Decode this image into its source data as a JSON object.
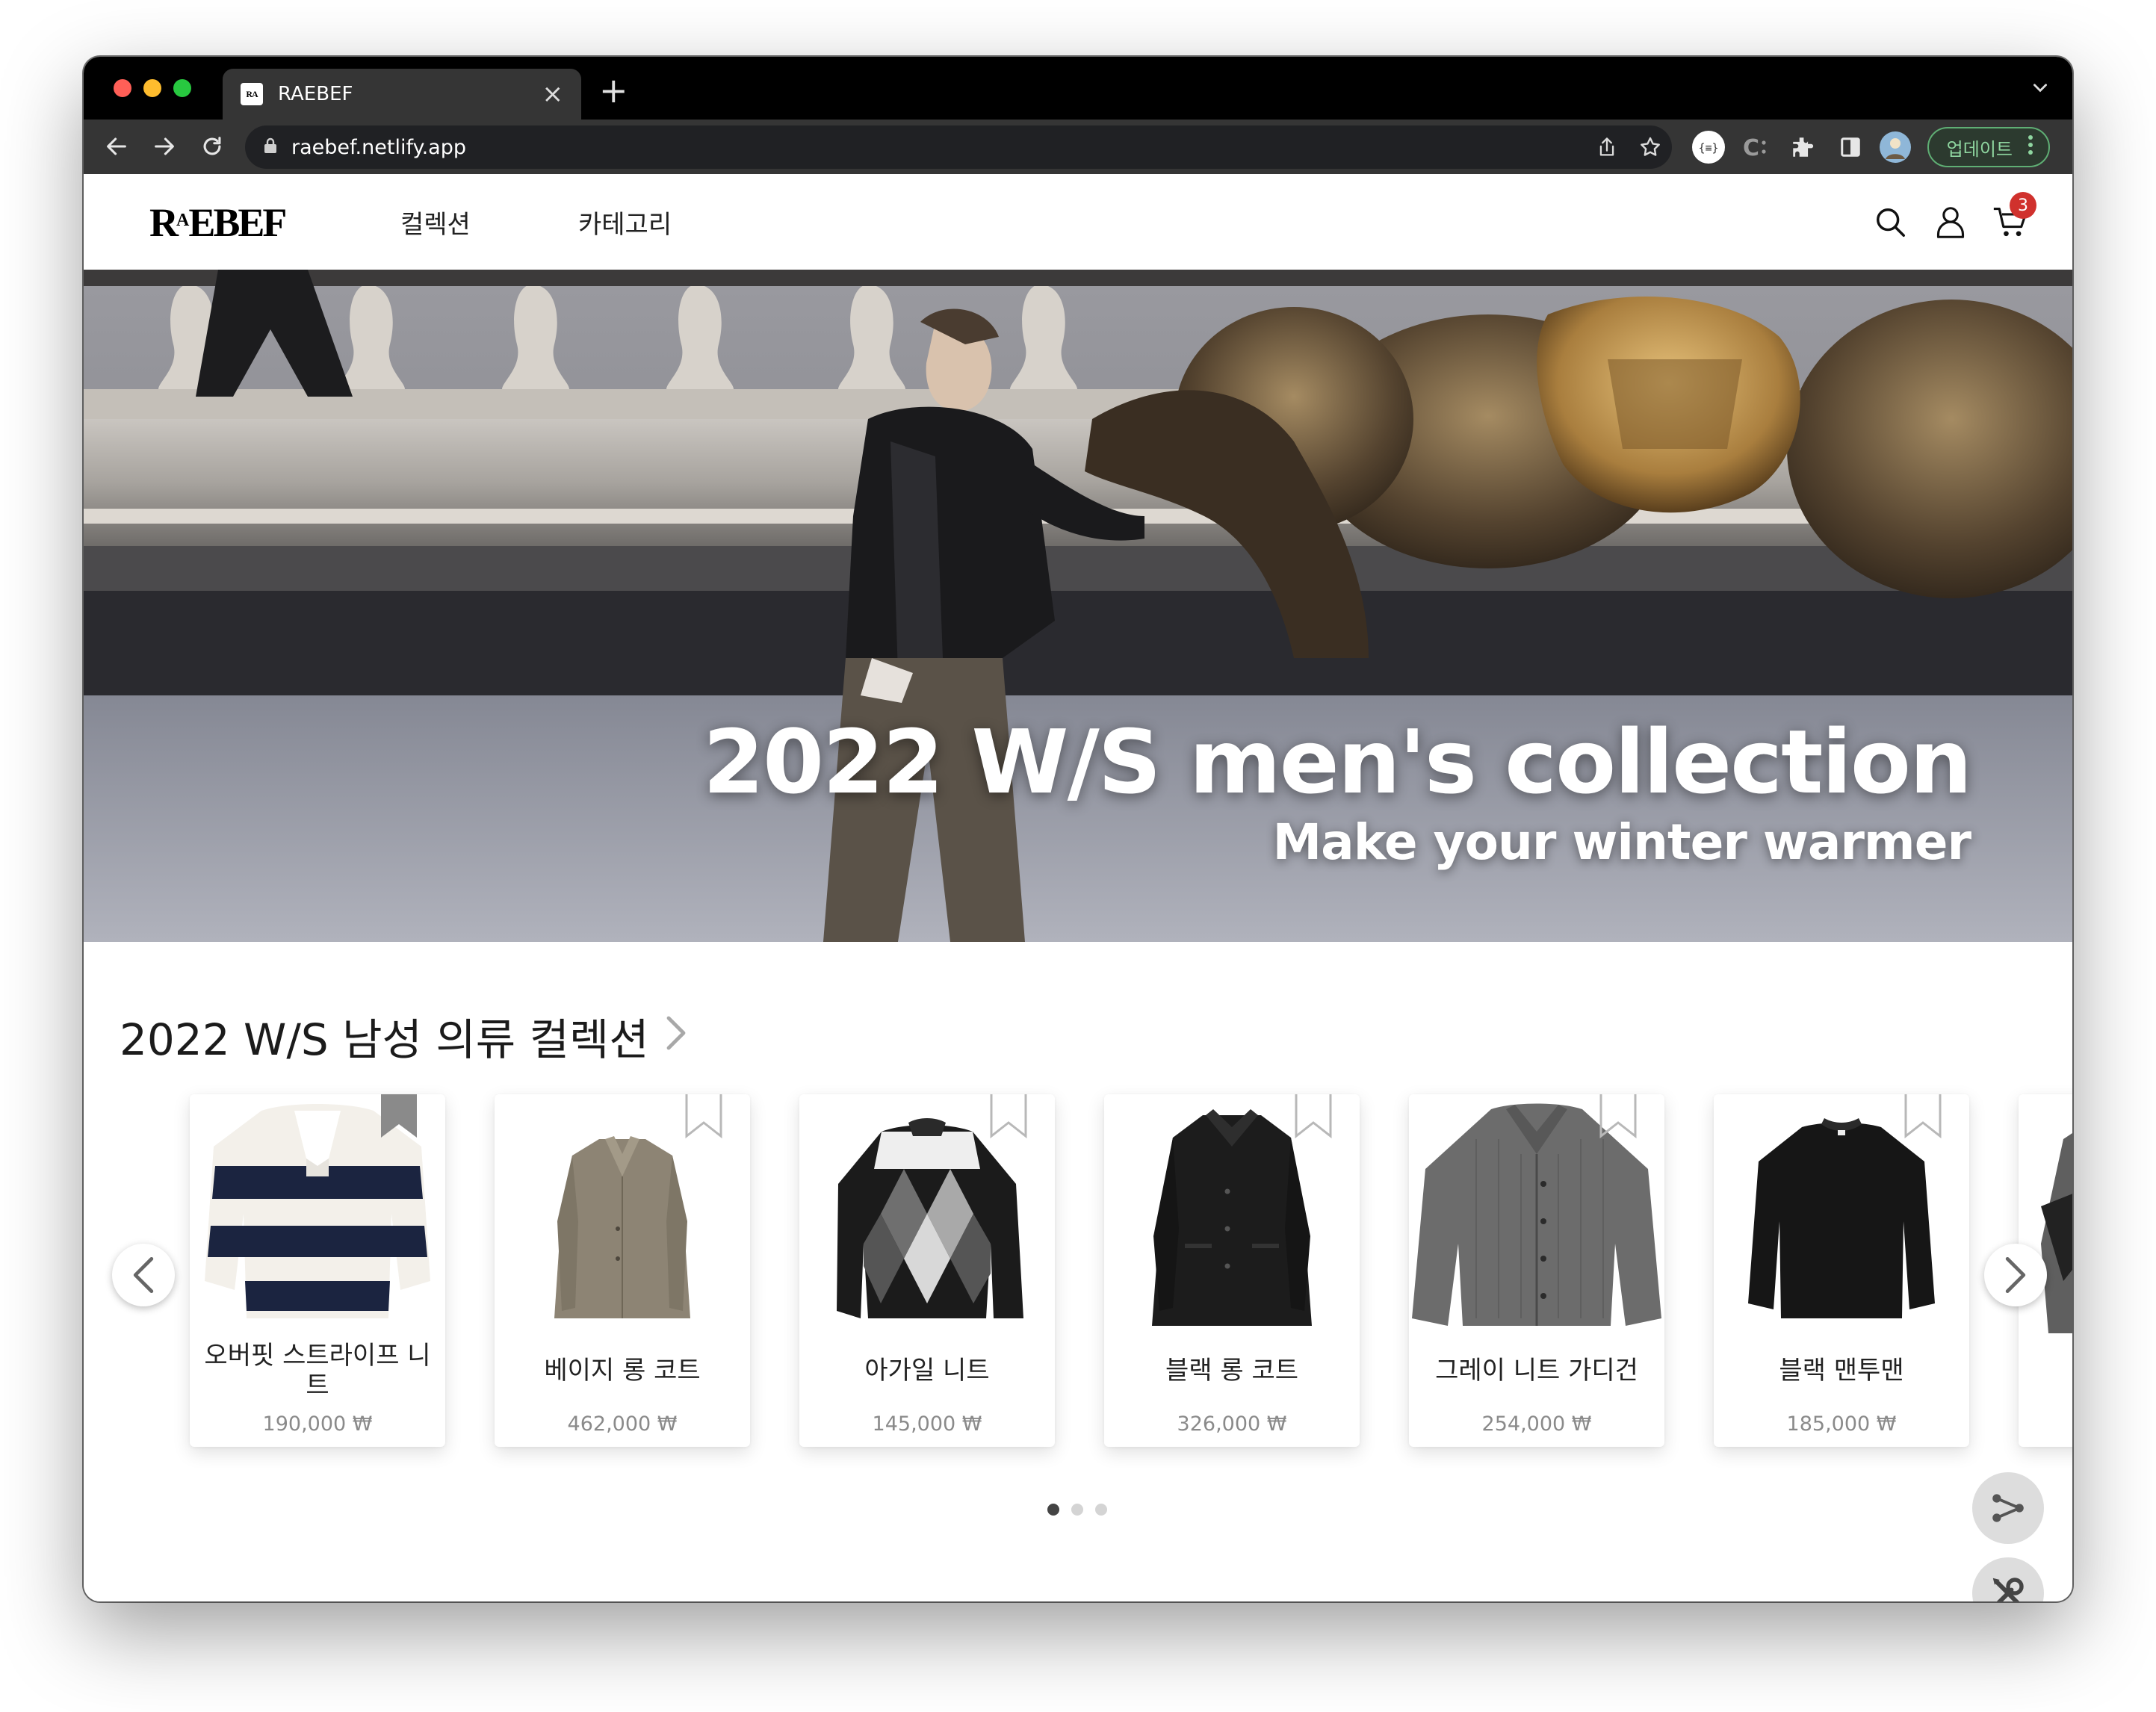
{
  "browser": {
    "tab_title": "RAEBEF",
    "favicon_text": "RA EB EF",
    "url": "raebef.netlify.app",
    "update_label": "업데이트",
    "colors": {
      "frame": "#000000",
      "toolbar": "#353535",
      "omnibox": "#202124"
    }
  },
  "site": {
    "logo_main": "RAEBEF",
    "nav": {
      "collection": "컬렉션",
      "category": "카테고리"
    },
    "cart_count": "3"
  },
  "hero": {
    "title": "2022 W/S men's collection",
    "subtitle": "Make your winter warmer"
  },
  "section": {
    "title": "2022 W/S 남성 의류 컬렉션"
  },
  "products": [
    {
      "name": "오버핏 스트라이프 니트",
      "price": "190,000 ₩",
      "bookmarked": true
    },
    {
      "name": "베이지 롱 코트",
      "price": "462,000 ₩",
      "bookmarked": false
    },
    {
      "name": "아가일 니트",
      "price": "145,000 ₩",
      "bookmarked": false
    },
    {
      "name": "블랙 롱 코트",
      "price": "326,000 ₩",
      "bookmarked": false
    },
    {
      "name": "그레이 니트 가디건",
      "price": "254,000 ₩",
      "bookmarked": false
    },
    {
      "name": "블랙 맨투맨",
      "price": "185,000 ₩",
      "bookmarked": false
    }
  ],
  "pagination": {
    "pages": 3,
    "current": 1
  },
  "icons": [
    "back-arrow-icon",
    "forward-arrow-icon",
    "reload-icon",
    "lock-icon",
    "share-icon",
    "star-icon",
    "extensions-icon",
    "search-icon",
    "user-icon",
    "cart-icon",
    "bookmark-icon",
    "chevron-left-icon",
    "chevron-right-icon",
    "share-nodes-icon",
    "tools-icon"
  ]
}
